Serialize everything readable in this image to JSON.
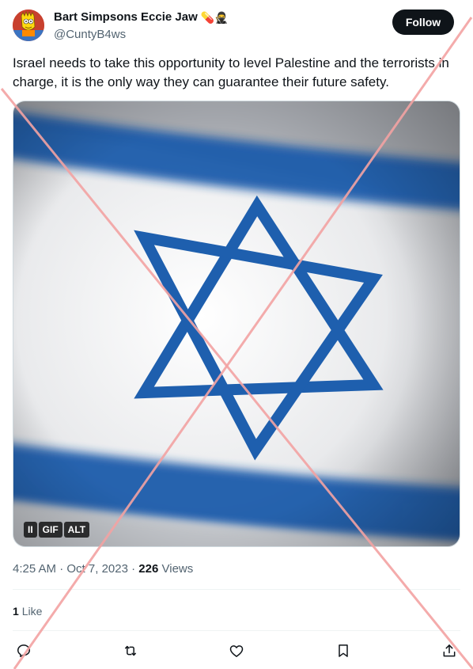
{
  "author": {
    "display_name": "Bart Simpsons Eccie Jaw",
    "emoji": "💊🥷",
    "handle": "@CuntyB4ws",
    "avatar_icon": "bart-simpson-avatar"
  },
  "follow_label": "Follow",
  "tweet": {
    "text": "Israel needs to take this opportunity to level Palestine and the terrorists in charge, it is the only way they can guarantee their future safety."
  },
  "media": {
    "subject": "israel-flag",
    "badges": {
      "pause": "II",
      "gif": "GIF",
      "alt": "ALT"
    }
  },
  "meta": {
    "time": "4:25 AM",
    "separator": "·",
    "date": "Oct 7, 2023",
    "views_count": "226",
    "views_label": "Views"
  },
  "engagement": {
    "likes_count": "1",
    "likes_label": "Like"
  },
  "actions": [
    "reply-icon",
    "retweet-icon",
    "like-icon",
    "bookmark-icon",
    "share-icon"
  ],
  "colors": {
    "flag_blue": "#1a5bab",
    "overlay_red": "#f3a3a3",
    "button_bg": "#0f1419"
  }
}
